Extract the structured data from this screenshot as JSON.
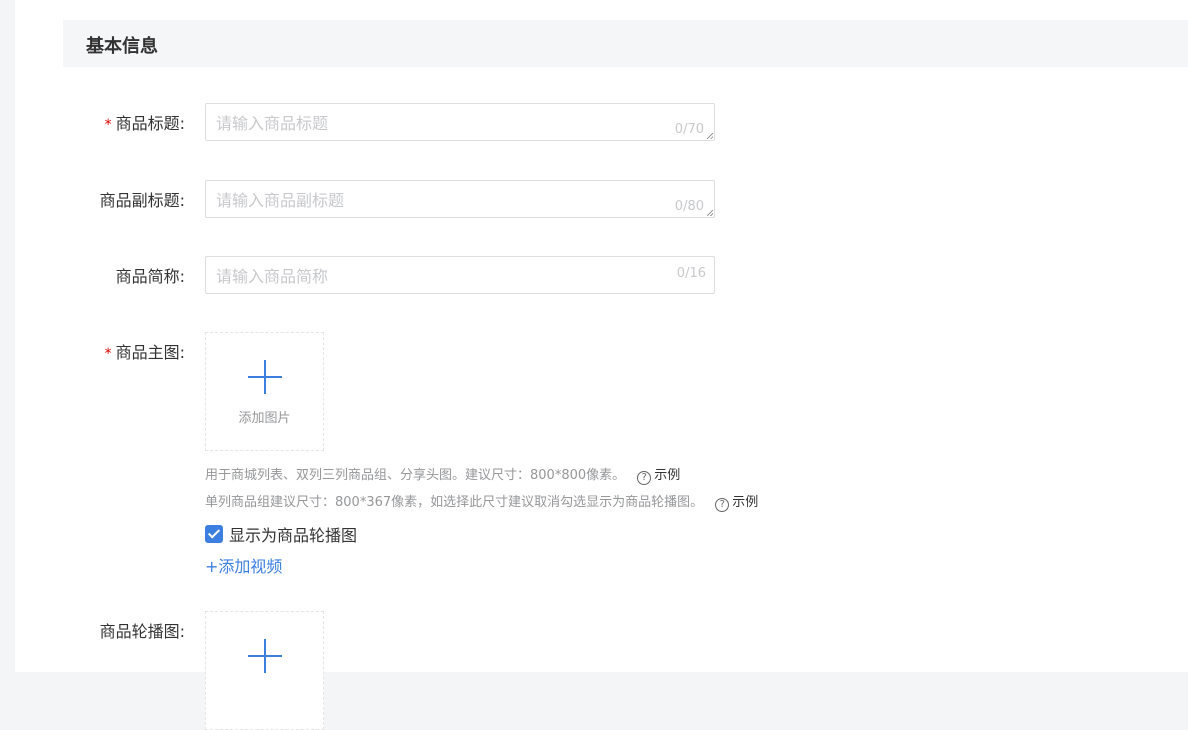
{
  "section": {
    "title": "基本信息"
  },
  "fields": {
    "title": {
      "required": "*",
      "label": "商品标题:",
      "placeholder": "请输入商品标题",
      "count": "0/70"
    },
    "subtitle": {
      "label": "商品副标题:",
      "placeholder": "请输入商品副标题",
      "count": "0/80"
    },
    "short_name": {
      "label": "商品简称:",
      "placeholder": "请输入商品简称",
      "count": "0/16"
    },
    "main_image": {
      "required": "*",
      "label": "商品主图:",
      "upload_text": "添加图片",
      "hint1": "用于商城列表、双列三列商品组、分享头图。建议尺寸：800*800像素。",
      "hint1_example": "示例",
      "hint2": "单列商品组建议尺寸：800*367像素，如选择此尺寸建议取消勾选显示为商品轮播图。",
      "hint2_example": "示例",
      "checkbox_label": "显示为商品轮播图",
      "checkbox_checked": true,
      "add_video": "+添加视频"
    },
    "carousel": {
      "label": "商品轮播图:"
    }
  },
  "colors": {
    "accent": "#3d7fe0",
    "required": "#d40000",
    "muted": "#969799"
  },
  "icons": {
    "help": "question-circle-icon",
    "plus": "plus-icon",
    "check": "check-icon"
  }
}
